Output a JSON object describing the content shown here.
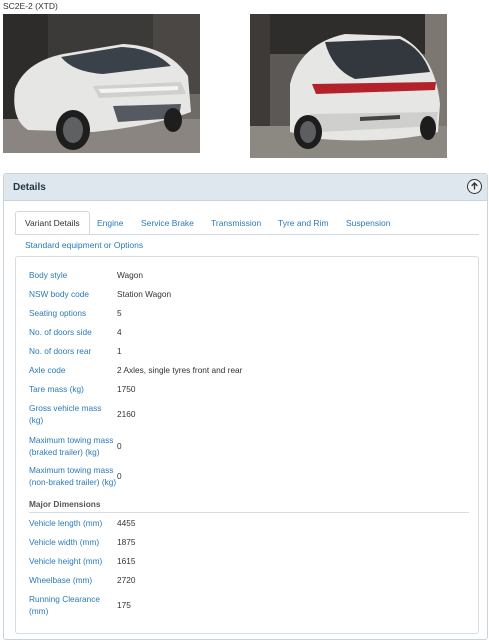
{
  "model_code": "SC2E-2 (XTD)",
  "panel": {
    "title": "Details",
    "collapse_icon": "arrow-up-circle-icon"
  },
  "tabs": [
    {
      "label": "Variant Details",
      "active": true
    },
    {
      "label": "Engine",
      "active": false
    },
    {
      "label": "Service Brake",
      "active": false
    },
    {
      "label": "Transmission",
      "active": false
    },
    {
      "label": "Tyre and Rim",
      "active": false
    },
    {
      "label": "Suspension",
      "active": false
    },
    {
      "label": "Standard equipment or Options",
      "active": false
    }
  ],
  "details": [
    {
      "label": "Body style",
      "value": "Wagon"
    },
    {
      "label": "NSW body code",
      "value": "Station Wagon"
    },
    {
      "label": "Seating options",
      "value": "5"
    },
    {
      "label": "No. of doors side",
      "value": "4"
    },
    {
      "label": "No. of doors rear",
      "value": "1"
    },
    {
      "label": "Axle code",
      "value": "2 Axles, single tyres front and rear"
    },
    {
      "label": "Tare mass (kg)",
      "value": "1750"
    },
    {
      "label": "Gross vehicle mass (kg)",
      "value": "2160"
    },
    {
      "label": "Maximum towing mass (braked trailer) (kg)",
      "value": "0"
    },
    {
      "label": "Maximum towing mass (non-braked trailer) (kg)",
      "value": "0"
    }
  ],
  "dimensions": {
    "heading": "Major Dimensions",
    "rows": [
      {
        "label": "Vehicle length (mm)",
        "value": "4455"
      },
      {
        "label": "Vehicle width (mm)",
        "value": "1875"
      },
      {
        "label": "Vehicle height (mm)",
        "value": "1615"
      },
      {
        "label": "Wheelbase (mm)",
        "value": "2720"
      },
      {
        "label": "Running Clearance (mm)",
        "value": "175"
      }
    ]
  },
  "colors": {
    "link": "#2a7ab8",
    "panel_header": "#dfe7ee",
    "car_body": "#e6e6e4"
  }
}
